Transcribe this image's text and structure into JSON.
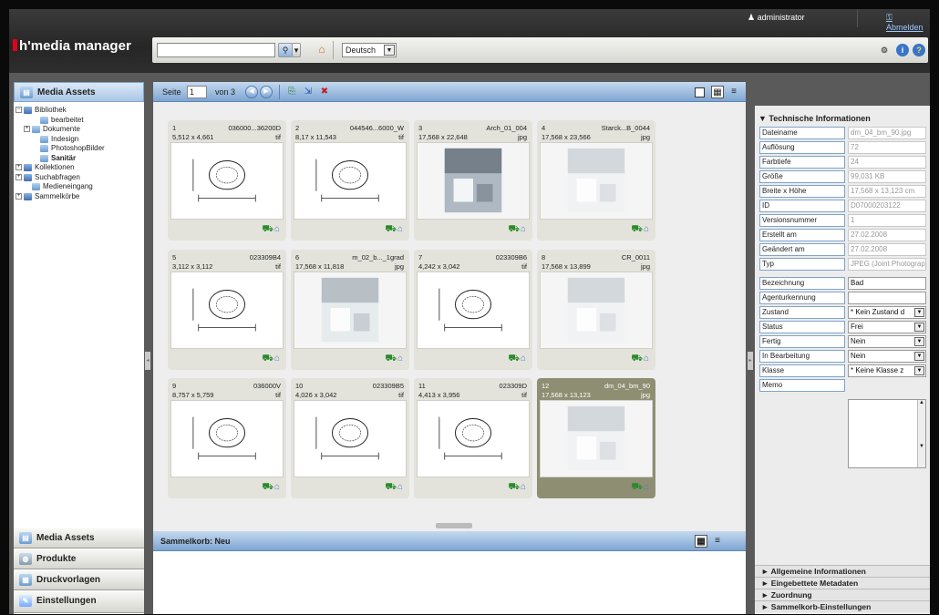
{
  "header": {
    "logo": "h'media manager",
    "user": "administrator",
    "logout": "Abmelden",
    "language": "Deutsch"
  },
  "left": {
    "top_section": "Media Assets",
    "tree": [
      {
        "label": "Bibliothek",
        "level": 0,
        "bold": false
      },
      {
        "label": "bearbeitet",
        "level": 2,
        "bold": false
      },
      {
        "label": "Dokumente",
        "level": 1,
        "bold": false
      },
      {
        "label": "Indesign",
        "level": 2,
        "bold": false
      },
      {
        "label": "PhotoshopBilder",
        "level": 2,
        "bold": false
      },
      {
        "label": "Sanitär",
        "level": 2,
        "bold": true
      },
      {
        "label": "Kollektionen",
        "level": 0,
        "bold": false
      },
      {
        "label": "Suchabfragen",
        "level": 0,
        "bold": false
      },
      {
        "label": "Medieneingang",
        "level": 1,
        "bold": false
      },
      {
        "label": "Sammelkörbe",
        "level": 0,
        "bold": false
      }
    ],
    "nav": [
      "Media Assets",
      "Produkte",
      "Druckvorlagen",
      "Einstellungen"
    ]
  },
  "pager": {
    "label": "Seite",
    "page": "1",
    "of": "von 3"
  },
  "assets": [
    {
      "num": "1",
      "code": "036000...36200D",
      "dim": "5,512 x 4,661",
      "ext": "tif",
      "kind": "drawing"
    },
    {
      "num": "2",
      "code": "044546...6000_W",
      "dim": "8,17 x 11,543",
      "ext": "tif",
      "kind": "drawing"
    },
    {
      "num": "3",
      "code": "Arch_01_004",
      "dim": "17,568 x 22,648",
      "ext": "jpg",
      "kind": "photo"
    },
    {
      "num": "4",
      "code": "Starck...B_0044",
      "dim": "17,568 x 23,566",
      "ext": "jpg",
      "kind": "photo"
    },
    {
      "num": "5",
      "code": "023309B4",
      "dim": "3,112 x 3,112",
      "ext": "tif",
      "kind": "drawing"
    },
    {
      "num": "6",
      "code": "m_02_b..._1grad",
      "dim": "17,568 x 11,818",
      "ext": "jpg",
      "kind": "photo"
    },
    {
      "num": "7",
      "code": "023309B6",
      "dim": "4,242 x 3,042",
      "ext": "tif",
      "kind": "drawing"
    },
    {
      "num": "8",
      "code": "CR_0011",
      "dim": "17,568 x 13,899",
      "ext": "jpg",
      "kind": "photo"
    },
    {
      "num": "9",
      "code": "036000V",
      "dim": "8,757 x 5,759",
      "ext": "tif",
      "kind": "drawing"
    },
    {
      "num": "10",
      "code": "023309B5",
      "dim": "4,026 x 3,042",
      "ext": "tif",
      "kind": "drawing"
    },
    {
      "num": "11",
      "code": "023309D",
      "dim": "4,413 x 3,956",
      "ext": "tif",
      "kind": "drawing"
    },
    {
      "num": "12",
      "code": "dm_04_bm_90",
      "dim": "17,568 x 13,123",
      "ext": "jpg",
      "kind": "photo",
      "selected": true
    }
  ],
  "basket": {
    "title": "Sammelkorb: Neu"
  },
  "properties": {
    "title": "▼ Technische Informationen",
    "rows": [
      {
        "label": "Dateiname",
        "value": "dm_04_bm_90.jpg",
        "editable": false,
        "dropdown": false
      },
      {
        "label": "Auflösung",
        "value": "72",
        "editable": false,
        "dropdown": false
      },
      {
        "label": "Farbtiefe",
        "value": "24",
        "editable": false,
        "dropdown": false
      },
      {
        "label": "Größe",
        "value": "99,031 KB",
        "editable": false,
        "dropdown": false
      },
      {
        "label": "Breite x Höhe",
        "value": "17,568 x 13,123 cm",
        "editable": false,
        "dropdown": false
      },
      {
        "label": "ID",
        "value": "D07000203122",
        "editable": false,
        "dropdown": false
      },
      {
        "label": "Versionsnummer",
        "value": "1",
        "editable": false,
        "dropdown": false
      },
      {
        "label": "Erstellt am",
        "value": "27.02.2008",
        "editable": false,
        "dropdown": false
      },
      {
        "label": "Geändert am",
        "value": "27.02.2008",
        "editable": false,
        "dropdown": false
      },
      {
        "label": "Typ",
        "value": "JPEG (Joint Photographic",
        "editable": false,
        "dropdown": false
      },
      {
        "label": "Bezeichnung",
        "value": "Bad",
        "editable": true,
        "dropdown": false
      },
      {
        "label": "Agenturkennung",
        "value": "",
        "editable": true,
        "dropdown": false
      },
      {
        "label": "Zustand",
        "value": "* Kein Zustand d",
        "editable": true,
        "dropdown": true
      },
      {
        "label": "Status",
        "value": "Frei",
        "editable": true,
        "dropdown": true
      },
      {
        "label": "Fertig",
        "value": "Nein",
        "editable": true,
        "dropdown": true
      },
      {
        "label": "In Bearbeitung",
        "value": "Nein",
        "editable": true,
        "dropdown": true
      },
      {
        "label": "Klasse",
        "value": "* Keine Klasse z",
        "editable": true,
        "dropdown": true
      },
      {
        "label": "Memo",
        "value": "",
        "editable": true,
        "dropdown": false
      }
    ],
    "sections": [
      "► Allgemeine Informationen",
      "► Eingebettete Metadaten",
      "► Zuordnung",
      "► Sammelkorb-Einstellungen"
    ]
  },
  "colors": {
    "accent": "#7ea5d2",
    "selected_card": "#8e8e73",
    "brand_red": "#e2001a"
  }
}
